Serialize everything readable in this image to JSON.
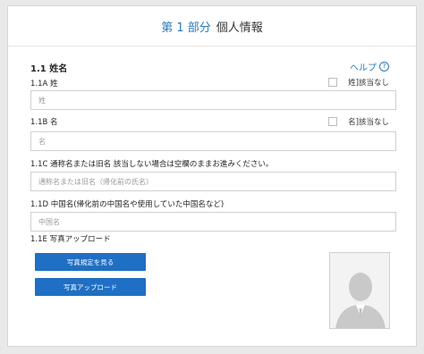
{
  "header": {
    "part_label": "第 1 部分",
    "section_title": "個人情報"
  },
  "section": {
    "heading": "1.1 姓名",
    "help_label": "ヘルプ",
    "help_icon": "?"
  },
  "fields": [
    {
      "label": "1.1A 姓",
      "placeholder": "姓",
      "not_applicable": "姓]該当なし"
    },
    {
      "label": "1.1B 名",
      "placeholder": "名",
      "not_applicable": "名]該当なし"
    },
    {
      "label": "1.1C 通称名または旧名 該当しない場合は空欄のままお進みください。",
      "placeholder": "通称名または旧名（帰化前の氏名）"
    },
    {
      "label": "1.1D 中国名(帰化前の中国名や使用していた中国名など)",
      "placeholder": "中国名"
    }
  ],
  "photo": {
    "label": "1.1E 写真アップロード",
    "view_rules_button": "写真規定を見る",
    "upload_button": "写真アップロード",
    "placeholder_icon": "avatar-silhouette"
  },
  "colors": {
    "accent": "#2a7ab8",
    "button": "#1f6fc4"
  }
}
